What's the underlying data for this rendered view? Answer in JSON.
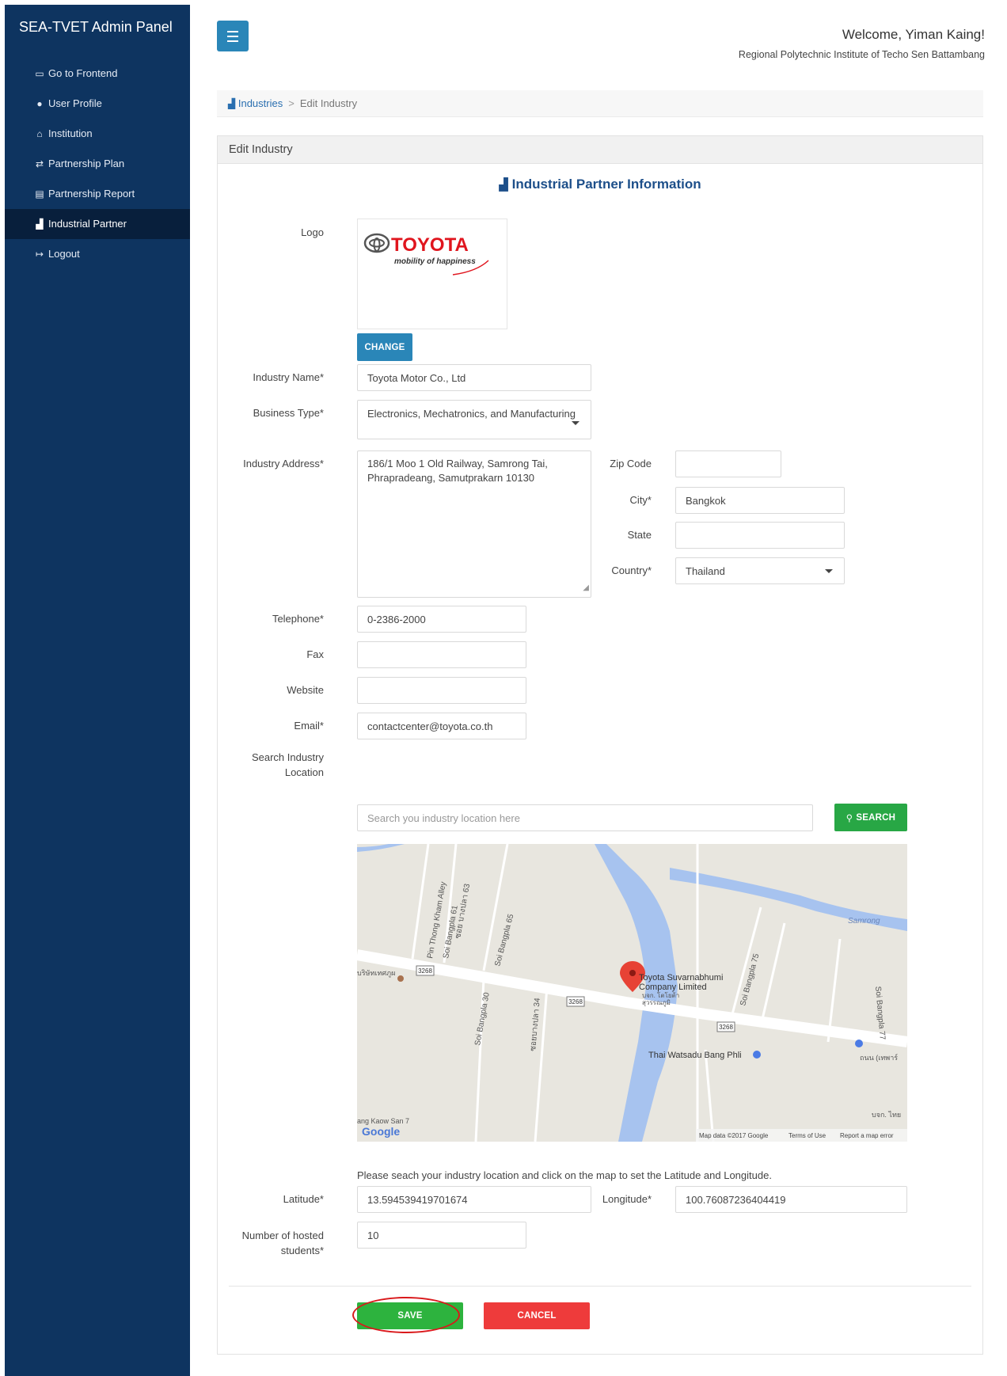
{
  "app": {
    "brand": "SEA-TVET Admin Panel"
  },
  "sidebar": {
    "items": [
      {
        "label": "Go to Frontend",
        "icon": "monitor-icon"
      },
      {
        "label": "User Profile",
        "icon": "user-icon"
      },
      {
        "label": "Institution",
        "icon": "institution-icon"
      },
      {
        "label": "Partnership Plan",
        "icon": "exchange-icon"
      },
      {
        "label": "Partnership Report",
        "icon": "report-icon"
      },
      {
        "label": "Industrial Partner",
        "icon": "industry-icon",
        "active": true
      },
      {
        "label": "Logout",
        "icon": "logout-icon"
      }
    ]
  },
  "header": {
    "welcome": "Welcome, Yiman Kaing!",
    "institution": "Regional Polytechnic Institute of Techo Sen Battambang"
  },
  "breadcrumb": {
    "link": "Industries",
    "separator": ">",
    "current": "Edit Industry"
  },
  "panel": {
    "title": "Edit Industry",
    "section_title": "Industrial Partner Information"
  },
  "form": {
    "logo": {
      "label": "Logo",
      "brand_text": "TOYOTA",
      "tagline": "mobility of happiness",
      "change_label": "CHANGE"
    },
    "industry_name": {
      "label": "Industry Name*",
      "value": "Toyota Motor Co., Ltd"
    },
    "business_type": {
      "label": "Business Type*",
      "value": "Electronics, Mechatronics, and Manufacturing"
    },
    "address": {
      "label": "Industry Address*",
      "line1": "186/1 Moo 1 Old Railway, Samrong Tai,",
      "line2": "Phrapradeang, Samutprakarn 10130"
    },
    "zip": {
      "label": "Zip Code",
      "value": ""
    },
    "city": {
      "label": "City*",
      "value": "Bangkok"
    },
    "state": {
      "label": "State",
      "value": ""
    },
    "country": {
      "label": "Country*",
      "value": "Thailand"
    },
    "telephone": {
      "label": "Telephone*",
      "value": "0-2386-2000"
    },
    "fax": {
      "label": "Fax",
      "value": ""
    },
    "website": {
      "label": "Website",
      "value": ""
    },
    "email": {
      "label": "Email*",
      "value": "contactcenter@toyota.co.th"
    },
    "search": {
      "label_line1": "Search Industry",
      "label_line2": "Location",
      "placeholder": "Search you industry location here",
      "button": "SEARCH"
    },
    "map": {
      "roads": [
        "Pin Thong Kham Alley",
        "Soi Bangpla 61",
        "ซอย บางปลา 63",
        "Soi Bangpla 65",
        "Soi Bangpla 30",
        "ซอยบางปลา 34",
        "Soi Bangpla 75",
        "Soi Bangpla 77",
        "Samrong"
      ],
      "places": [
        "Toyota Suvarnabhumi",
        "Company Limited",
        "บจก. โตโยต้า",
        "สุวรรณภูมิ",
        "Thai Watsadu Bang Phli",
        "บริษัทเทศภูผ",
        "ถนน (เทพาร์",
        "บจก. ไทย",
        "ang Kaow San 7"
      ],
      "highway": "3268",
      "google": "Google",
      "footer": [
        "Map data ©2017 Google",
        "Terms of Use",
        "Report a map error"
      ]
    },
    "hint": "Please seach your industry location and click on the map to set the Latitude and Longitude.",
    "latitude": {
      "label": "Latitude*",
      "value": "13.594539419701674"
    },
    "longitude": {
      "label": "Longitude*",
      "value": "100.76087236404419"
    },
    "hosted": {
      "label_line1": "Number of hosted",
      "label_line2": "students*",
      "value": "10"
    },
    "save_label": "SAVE",
    "cancel_label": "CANCEL"
  }
}
